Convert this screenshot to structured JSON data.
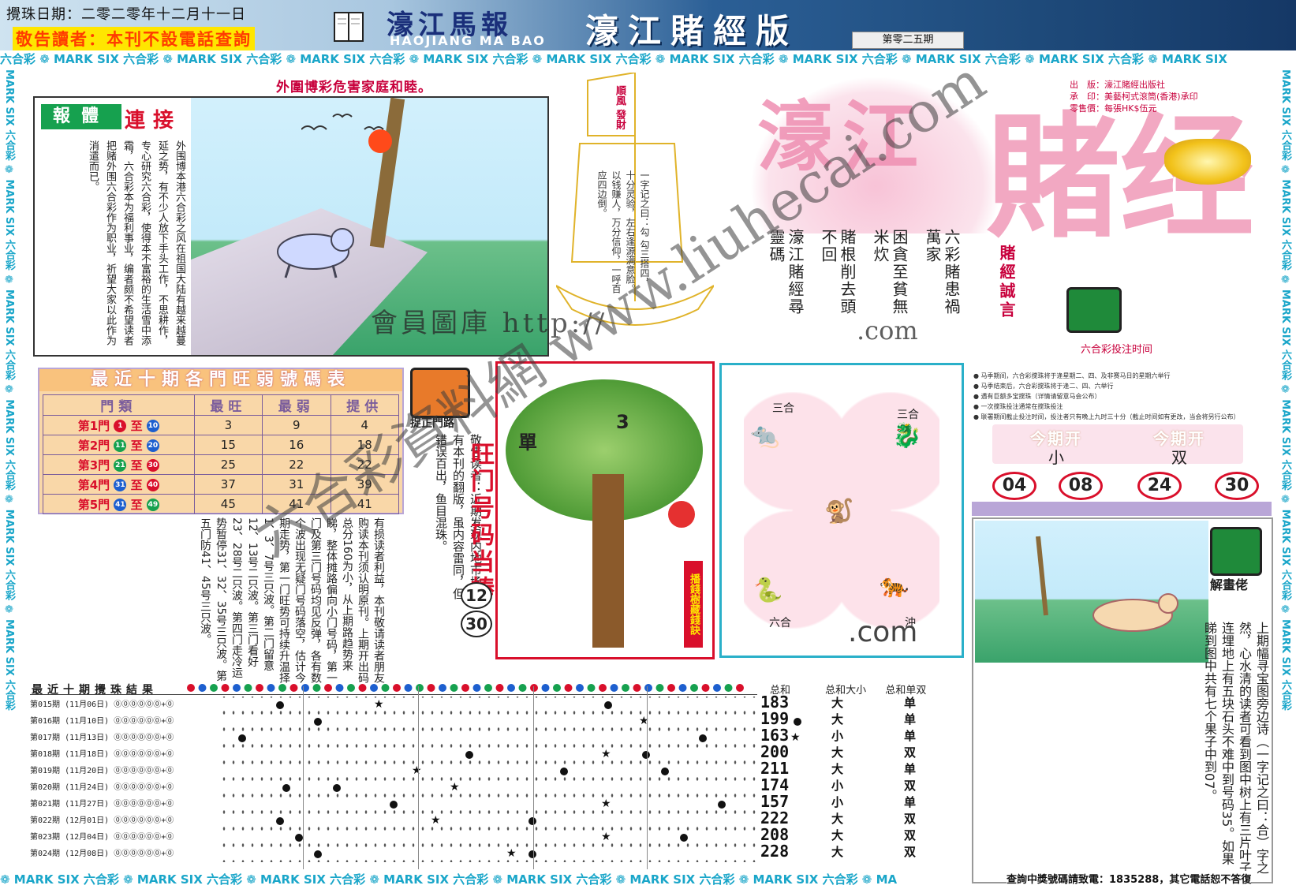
{
  "header": {
    "draw_date": "攪珠日期：二零二零年十二月十一日",
    "notice": "敬告讀者：本刊不設電話查詢",
    "cn_title": "濠江馬報",
    "en_title": "HAOJIANG MA BAO",
    "edition": "濠江賭經版",
    "issue": "第零二五期"
  },
  "border_text": "六合彩 ❁ MARK SIX 六合彩 ❁ MARK SIX 六合彩 ❁ MARK SIX 六合彩 ❁ MARK SIX 六合彩 ❁ MARK SIX 六合彩 ❁ MARK SIX 六合彩 ❁ MARK SIX 六合彩 ❁ MARK SIX 六合彩 ❁ MARK SIX 六合彩 ❁ MARK SIX",
  "bottom_border_text": "❁ MARK SIX 六合彩 ❁ MARK SIX 六合彩 ❁ MARK SIX 六合彩 ❁ MARK SIX 六合彩 ❁ MARK SIX 六合彩 ❁ MARK SIX 六合彩 ❁ MARK SIX 六合彩 ❁ MA",
  "side_text": "MARK SIX 六合彩 ❁ MARK SIX 六合彩 ❁ MARK SIX 六合彩 ❁ MARK SIX 六合彩 ❁ MARK SIX 六合彩 ❁ MARK SIX 六合彩",
  "story": {
    "warning": "外圍博彩危害家庭和睦。",
    "tag": "報體",
    "title": "連接",
    "text": "外围博本港六合彩之风在祖国大陆有越来越蔓延之势，有不少人放下手头工作，不思耕作，专心研究六合彩，使得本不富裕的生活雪中添霜，六合彩本为福利事业，编者颇不希望读者把赌外围六合彩作为职业，祈望大家以此作为消遣而已。",
    "watermark": "會員圖庫 http://"
  },
  "boat": {
    "sail": "順風 發財",
    "poem": "一字记之曰：勾 勾三搭四，十分灵验，左右逢源满意脸。以钱赚人，万分信仰，一呼百应四边倒。"
  },
  "title_block": {
    "big1": "濠江",
    "big2": "賭经",
    "publisher": "出　版：濠江賭經出版社",
    "printer": "承　印：美藝柯式滾筒(香港)承印",
    "price": "零售價：每張HK$伍元",
    "poem_cols": [
      "六彩賭患禍萬家",
      "困貪至貧無米炊",
      "賭根削去頭不回",
      "濠江賭經尋靈碼"
    ],
    "motto": "賭經誠言",
    "bet_time_title": "六合彩投注时间",
    "watermark2": ".com"
  },
  "bet_notes": [
    "● 马季期间，六合彩搅珠将于逢星期二、四、及非赛马日的星期六举行",
    "● 马季结束后，六合彩搅珠将于逢二、四、六举行",
    "● 遇有巨额多宝搅珠（详情请留意马会公布）",
    "● 一次搅珠投注通常在搅珠投注",
    "● 联署期间截止投注时间，投注者只有晚上九时三十分（截止时间如有更改，当会将另行公布）"
  ],
  "result": {
    "label1": "今期开",
    "value1": "小",
    "label2": "今期开",
    "value2": "双",
    "numbers": [
      "04",
      "08",
      "24",
      "30"
    ]
  },
  "hot_table": {
    "title": "最近十期各門旺弱號碼表",
    "headers": [
      "門類",
      "最旺",
      "最弱",
      "提供"
    ],
    "rows": [
      {
        "door": "第1門",
        "from": "1",
        "to": "10",
        "from_color": "#d90f2b",
        "to_color": "#1d5fcf",
        "hot": "3",
        "cold": "9",
        "pick": "4"
      },
      {
        "door": "第2門",
        "from": "11",
        "to": "20",
        "from_color": "#16a14f",
        "to_color": "#1d5fcf",
        "hot": "15",
        "cold": "16",
        "pick": "18"
      },
      {
        "door": "第3門",
        "from": "21",
        "to": "30",
        "from_color": "#16a14f",
        "to_color": "#d90f2b",
        "hot": "25",
        "cold": "22",
        "pick": "22"
      },
      {
        "door": "第4門",
        "from": "31",
        "to": "40",
        "from_color": "#1d5fcf",
        "to_color": "#d90f2b",
        "hot": "37",
        "cold": "31",
        "pick": "39"
      },
      {
        "door": "第5門",
        "from": "41",
        "to": "49",
        "from_color": "#1d5fcf",
        "to_color": "#16a14f",
        "hot": "45",
        "cold": "41",
        "pick": "41"
      }
    ],
    "between": "至"
  },
  "door": {
    "label": "捉正門路",
    "col": "敬告读者：近期发现内地市场上有本刊的翻版，虽内容雷同，但错误百出，鱼目混珠。",
    "head": "旺门号码当捧",
    "num1": "12",
    "num2": "30"
  },
  "analysis": "有损读者利益，本刊敬请读者朋友购读本刊须认明原刊。上期开出码总分160为小，从上期路趋势来睇，整体摊路偏向小门号码，第一门及第三门号码均见反弹，各有数个波出现无疑门号码落空，估计今期走势，第一门旺势可持续升温择1、3、7号三只波。第二门留意12、13号二只波。第三门看好23、28号二只波。第四门走冷运势暂停31、32、35号三只波。第五门防41、45号三只波。",
  "tree": {
    "dan": "單",
    "num": "3",
    "tag": "播錢樹藏錢訣",
    "watermark": "會員圖庫 http://"
  },
  "zodiac": {
    "label_tl": "三合",
    "label_tr": "三合",
    "label_bl": "六合",
    "label_br": "沖",
    "com": ".com"
  },
  "chart": {
    "title": "最近十期攪珠結果",
    "col_sum": "总和",
    "col_size": "总和大小",
    "col_parity": "总和单双",
    "rows": [
      {
        "id": "第015期 (11月06日) ⓪⓪⓪⓪⓪⓪+⓪",
        "sum": "183",
        "size": "大",
        "parity": "单"
      },
      {
        "id": "第016期 (11月10日) ⓪⓪⓪⓪⓪⓪+⓪",
        "sum": "199",
        "size": "大",
        "parity": "单"
      },
      {
        "id": "第017期 (11月13日) ⓪⓪⓪⓪⓪⓪+⓪",
        "sum": "163",
        "size": "小",
        "parity": "单"
      },
      {
        "id": "第018期 (11月18日) ⓪⓪⓪⓪⓪⓪+⓪",
        "sum": "200",
        "size": "大",
        "parity": "双"
      },
      {
        "id": "第019期 (11月20日) ⓪⓪⓪⓪⓪⓪+⓪",
        "sum": "211",
        "size": "大",
        "parity": "单"
      },
      {
        "id": "第020期 (11月24日) ⓪⓪⓪⓪⓪⓪+⓪",
        "sum": "174",
        "size": "小",
        "parity": "双"
      },
      {
        "id": "第021期 (11月27日) ⓪⓪⓪⓪⓪⓪+⓪",
        "sum": "157",
        "size": "小",
        "parity": "单"
      },
      {
        "id": "第022期 (12月01日) ⓪⓪⓪⓪⓪⓪+⓪",
        "sum": "222",
        "size": "大",
        "parity": "双"
      },
      {
        "id": "第023期 (12月04日) ⓪⓪⓪⓪⓪⓪+⓪",
        "sum": "208",
        "size": "大",
        "parity": "双"
      },
      {
        "id": "第024期 (12月08日) ⓪⓪⓪⓪⓪⓪+⓪",
        "sum": "228",
        "size": "大",
        "parity": "双"
      }
    ]
  },
  "right_bottom": {
    "label": "解畫佬",
    "text": "上期幅寻宝图旁边诗（一字记之曰：合）字之然，心水清的读者可看到图中树上有三片叶子连埋地上有五块石头不难中到号码35。如果睇到图中共有七个果子中到07。"
  },
  "footer_phone": "查詢中獎號碼請致電：1835288，其它電話恕不答復",
  "diag_watermark": "六合彩資料網 www.liuhecai.com"
}
